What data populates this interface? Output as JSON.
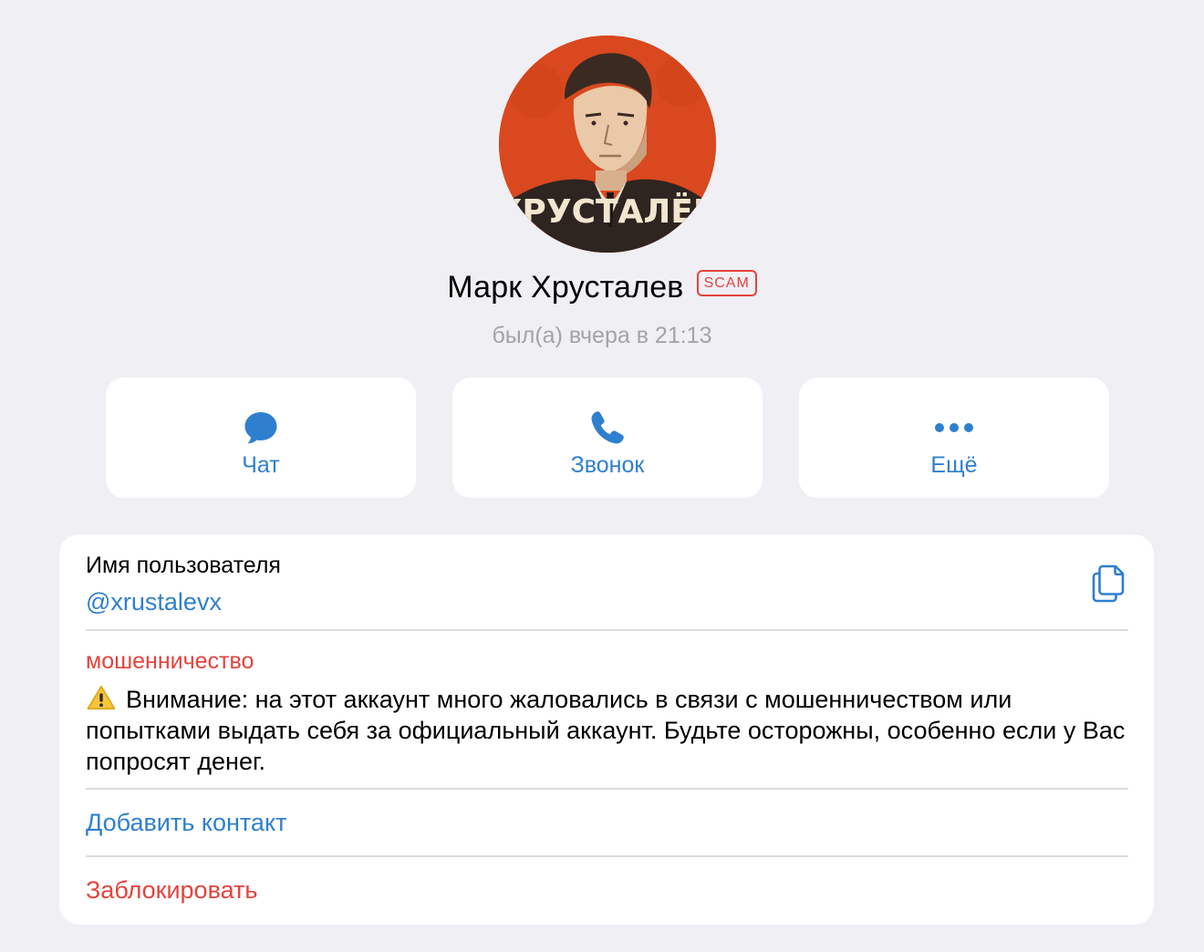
{
  "profile": {
    "name": "Марк Хрусталев",
    "badge": "SCAM",
    "last_seen": "был(а) вчера в 21:13",
    "avatar_icon": "profile-photo",
    "avatar_text": "ХРУСТАЛЁВ"
  },
  "actions": [
    {
      "label": "Чат",
      "icon": "chat-bubble-icon"
    },
    {
      "label": "Звонок",
      "icon": "phone-icon"
    },
    {
      "label": "Ещё",
      "icon": "more-dots-icon"
    }
  ],
  "info": {
    "username_title": "Имя пользователя",
    "username_value": "@xrustalevx",
    "copy_icon": "copy-icon",
    "scam_title": "мошенничество",
    "warning_icon": "warning-sign-icon",
    "warning_text": "Внимание: на этот аккаунт много жаловались в связи с мошенничеством или попытками выдать себя за официальный аккаунт. Будьте осторожны, особенно если у Вас попросят денег.",
    "add_contact": "Добавить контакт",
    "block": "Заблокировать"
  },
  "colors": {
    "background": "#efeff4",
    "accent": "#2f7fcf",
    "danger": "#e5433c",
    "card": "#ffffff",
    "secondary_text": "#a3a3a8"
  }
}
